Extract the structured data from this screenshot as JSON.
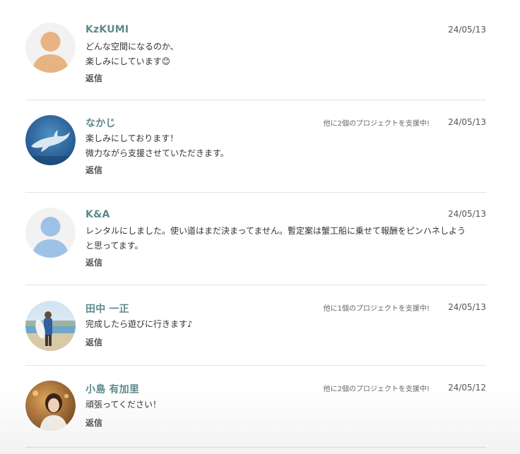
{
  "comments": [
    {
      "author": "KzKUMI",
      "date": "24/05/13",
      "backer_note": "",
      "lines": [
        "どんな空間になるのか、",
        "楽しみにしています😊"
      ],
      "reply": "返信",
      "avatar": "default-avatar-orange"
    },
    {
      "author": "なかじ",
      "date": "24/05/13",
      "backer_note": "他に2個のプロジェクトを支援中!",
      "lines": [
        "楽しみにしております！",
        "微力ながら支援させていただきます。"
      ],
      "reply": "返信",
      "avatar": "dolphin-photo"
    },
    {
      "author": "K&A",
      "date": "24/05/13",
      "backer_note": "",
      "lines": [
        "レンタルにしました。使い道はまだ決まってません。暫定案は蟹工船に乗せて報酬をピンハネしよう",
        "と思ってます。"
      ],
      "reply": "返信",
      "avatar": "default-avatar-blue"
    },
    {
      "author": "田中 一正",
      "date": "24/05/13",
      "backer_note": "他に1個のプロジェクトを支援中!",
      "lines": [
        "完成したら遊びに行きます♪"
      ],
      "reply": "返信",
      "avatar": "beach-photo"
    },
    {
      "author": "小島 有加里",
      "date": "24/05/12",
      "backer_note": "他に2個のプロジェクトを支援中!",
      "lines": [
        "頑張ってください！"
      ],
      "reply": "返信",
      "avatar": "portrait-photo"
    }
  ],
  "colors": {
    "author": "#5f8a8b",
    "text": "#333333",
    "divider": "#e3e3e3",
    "avatar_orange": "#e8b383",
    "avatar_blue": "#9dc2e5",
    "avatar_bg": "#f2f2f2"
  }
}
